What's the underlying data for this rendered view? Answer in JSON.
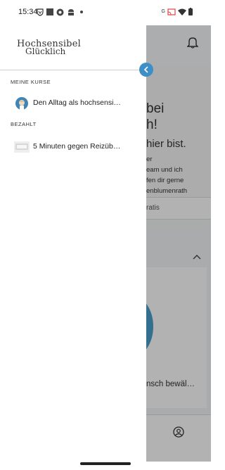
{
  "status": {
    "time": "15:34",
    "icons": [
      "vpn-icon",
      "square-icon",
      "chrome-icon",
      "android-icon",
      "dot-icon",
      "cast-icon",
      "wifi-icon",
      "battery-icon"
    ],
    "network_label": "G"
  },
  "drawer": {
    "logo_line1": "Hochsensibel",
    "logo_line2": "Glücklich",
    "section1_label": "MEINE KURSE",
    "section2_label": "BEZAHLT",
    "courses_mine": [
      {
        "title": "Den Alltag als hochsensi…",
        "icon": "course-avatar-icon"
      }
    ],
    "courses_paid": [
      {
        "title": "5 Minuten gegen Reizüb…",
        "icon": "course-thumbnail-icon"
      }
    ]
  },
  "background": {
    "hero_line1": "bei",
    "hero_line2": "h!",
    "hero_line3": "hier bist.",
    "hero_para": [
      "er",
      "eam und ich",
      "fen dir gerne",
      "enblumenrath"
    ],
    "ratis": "ratis",
    "card_title": "nsch bewäl…"
  },
  "colors": {
    "accent": "#3d8fc6",
    "scrim": "rgba(0,0,0,0.30)"
  }
}
